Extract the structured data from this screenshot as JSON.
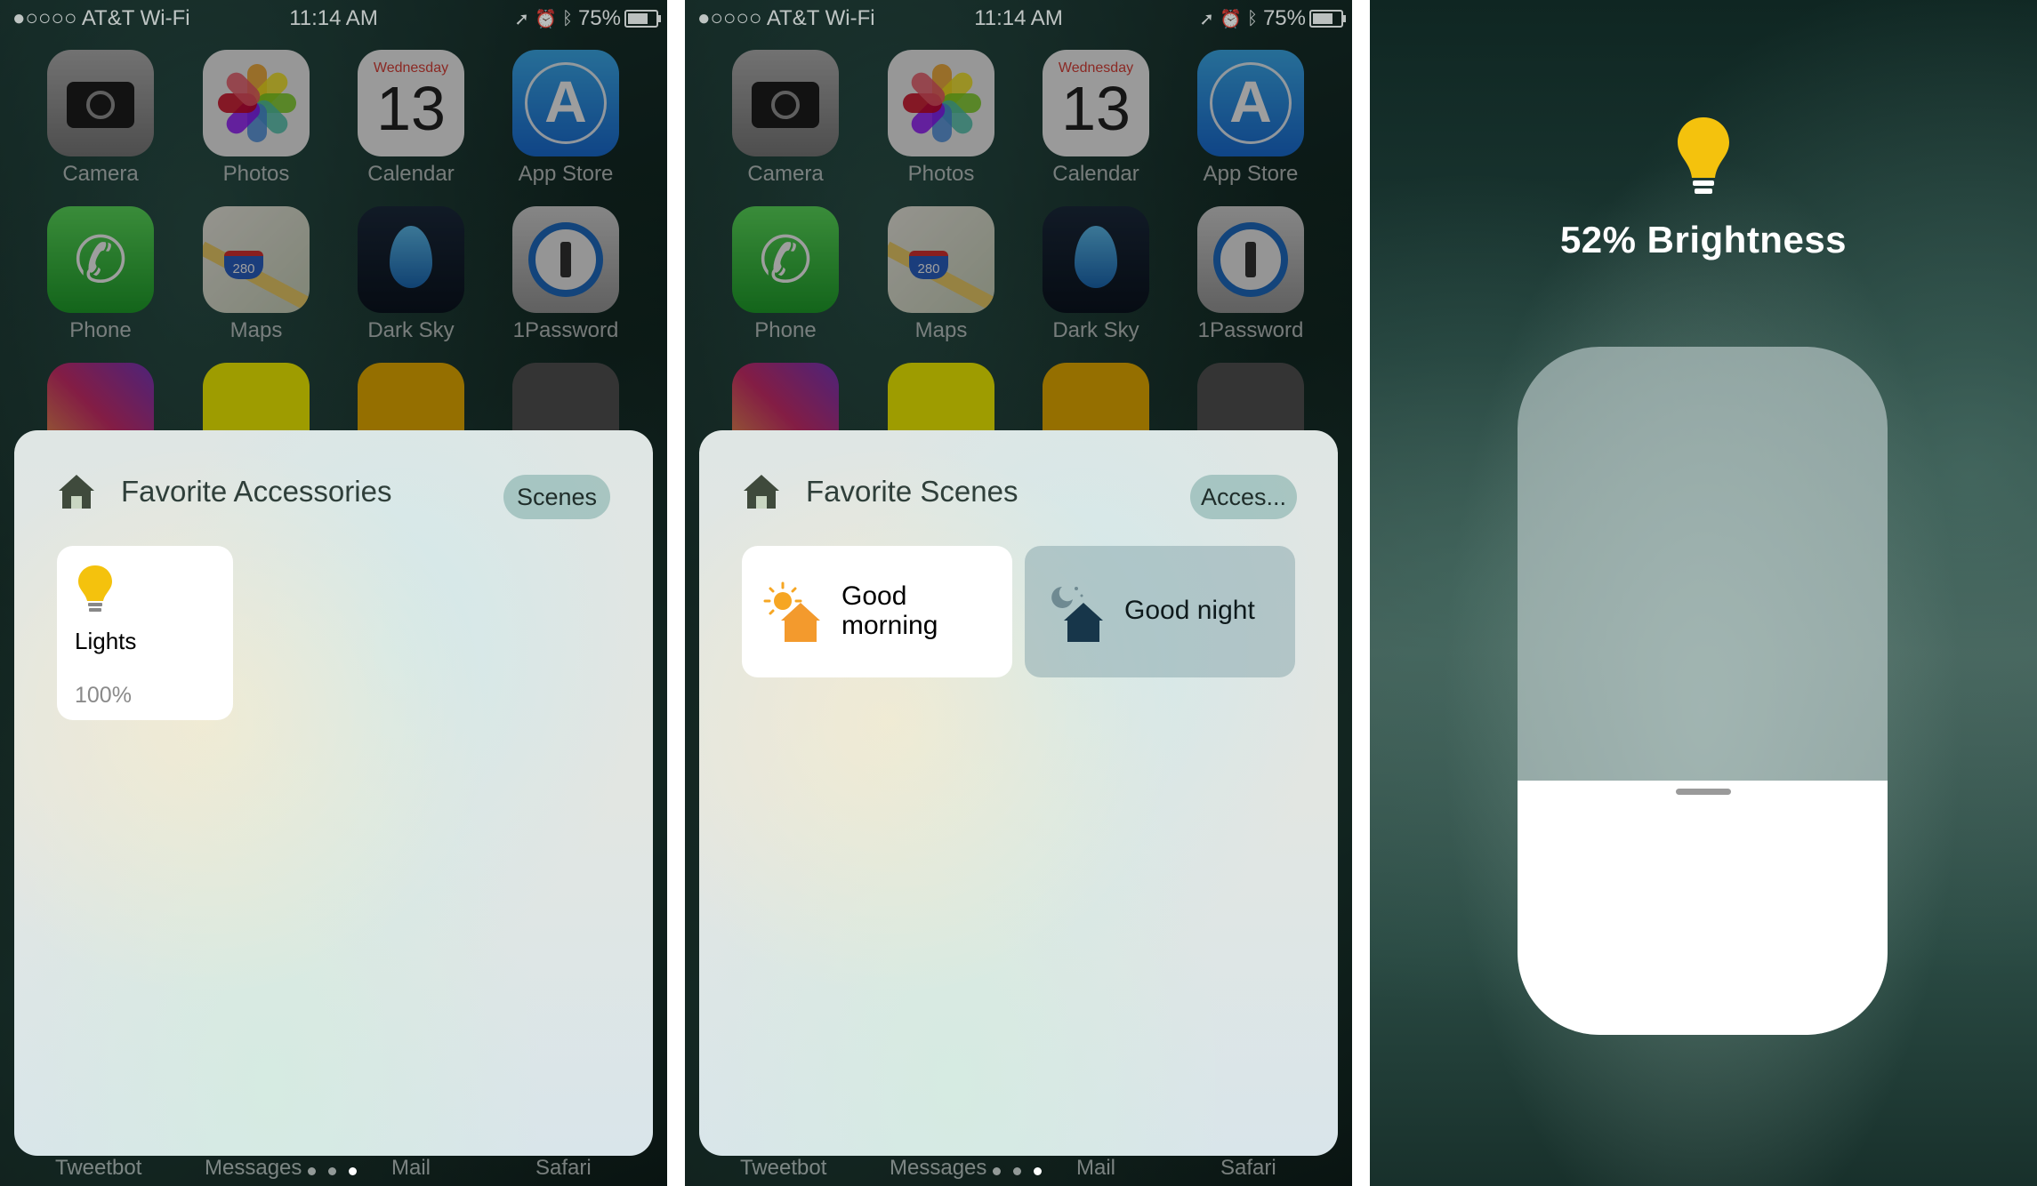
{
  "status_bar": {
    "carrier": "●○○○○ AT&T Wi-Fi",
    "time": "11:14 AM",
    "battery": "75%"
  },
  "apps": {
    "camera": "Camera",
    "photos": "Photos",
    "calendar": "Calendar",
    "calendar_day": "Wednesday",
    "calendar_date": "13",
    "appstore": "App Store",
    "phone": "Phone",
    "maps": "Maps",
    "maps_shield": "280",
    "darksky": "Dark Sky",
    "onepassword": "1Password"
  },
  "dock": {
    "tweetbot": "Tweetbot",
    "messages": "Messages",
    "mail": "Mail",
    "safari": "Safari"
  },
  "accessories_widget": {
    "title": "Favorite Accessories",
    "switch_button": "Scenes",
    "tile": {
      "name": "Lights",
      "value": "100%"
    }
  },
  "scenes_widget": {
    "title": "Favorite Scenes",
    "switch_button": "Acces...",
    "scenes": [
      {
        "label_line1": "Good",
        "label_line2": "morning",
        "active": true
      },
      {
        "label": "Good night",
        "active": false
      }
    ]
  },
  "brightness_view": {
    "label": "52% Brightness",
    "level": 0.52
  },
  "colors": {
    "bulb": "#f4c20d",
    "sun": "#f6a623",
    "house_orange": "#f39a2d",
    "house_night": "#17364a"
  }
}
